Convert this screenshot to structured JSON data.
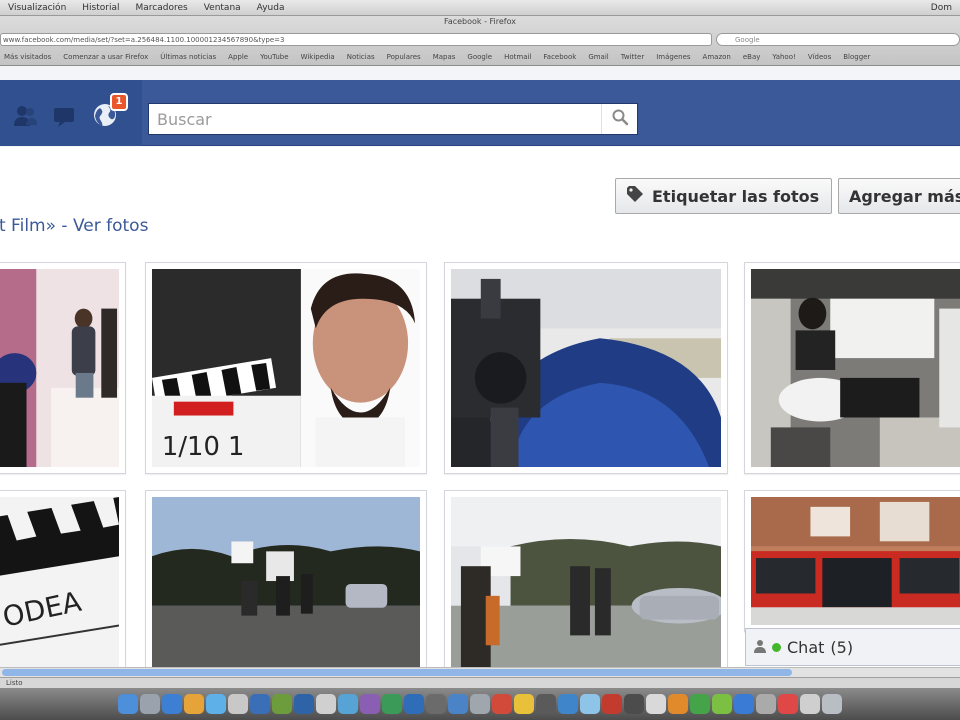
{
  "menubar": {
    "items": [
      "Visualización",
      "Historial",
      "Marcadores",
      "Ventana",
      "Ayuda"
    ],
    "clock": "Dom"
  },
  "browser": {
    "window_title": "Facebook - Firefox",
    "url": "www.facebook.com/media/set/?set=a.256484.1100.100001234567890&type=3",
    "search_placeholder": "Google",
    "bookmarks": [
      "Más visitados",
      "Comenzar a usar Firefox",
      "Últimas noticias",
      "Apple",
      "YouTube",
      "Wikipedia",
      "Noticias",
      "Populares",
      "Mapas",
      "Google",
      "Hotmail",
      "Facebook",
      "Gmail",
      "Twitter",
      "Imágenes",
      "Amazon",
      "eBay",
      "Yahoo!",
      "Vídeos",
      "Blogger"
    ]
  },
  "facebook": {
    "notification_count": "1",
    "search_placeholder": "Buscar"
  },
  "page": {
    "tag_button": "Etiquetar las fotos",
    "add_button": "Agregar más",
    "album_title": "rt Film»",
    "album_separator": " - ",
    "view_photos_link": "Ver fotos"
  },
  "chat": {
    "label": "Chat",
    "count": "(5)"
  },
  "status_bar": "Listo",
  "colors": {
    "fb_blue": "#3b5998",
    "fb_dark_blue": "#30508f",
    "notif_badge": "#e9562a",
    "chat_online": "#42b72a",
    "link_blue": "#3b5998"
  },
  "icons": {
    "friend_requests": "friends-icon",
    "messages": "messages-icon",
    "notifications": "globe-icon",
    "search": "magnifier-icon",
    "tag": "tag-icon",
    "chat_status": "online-dot-icon"
  }
}
